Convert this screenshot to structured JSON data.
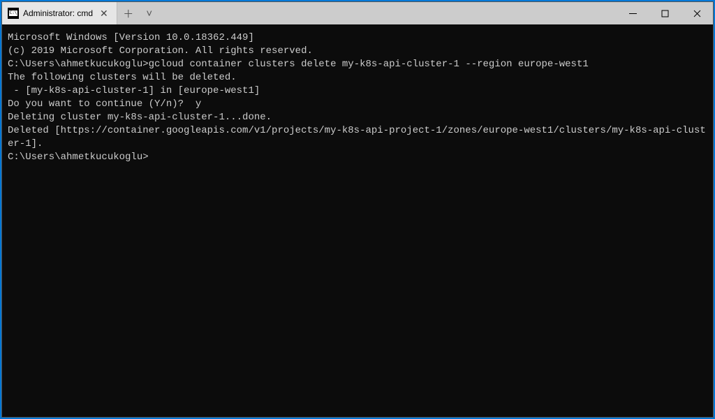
{
  "titlebar": {
    "tab_title": "Administrator: cmd",
    "tab_icon_text": "C:\\",
    "close_tab": "✕",
    "new_tab": "＋",
    "dropdown": "˅"
  },
  "window_controls": {
    "minimize": "—",
    "maximize": "☐",
    "close": "✕"
  },
  "terminal": {
    "line1": "Microsoft Windows [Version 10.0.18362.449]",
    "line2": "(c) 2019 Microsoft Corporation. All rights reserved.",
    "blank1": "",
    "prompt1": "C:\\Users\\ahmetkucukoglu>",
    "cmd1": "gcloud container clusters delete my-k8s-api-cluster-1 --region europe-west1",
    "line3": "The following clusters will be deleted.",
    "line4": " - [my-k8s-api-cluster-1] in [europe-west1]",
    "blank2": "",
    "line5": "Do you want to continue (Y/n)?  y",
    "blank3": "",
    "line6": "Deleting cluster my-k8s-api-cluster-1...done.",
    "line7": "Deleted [https://container.googleapis.com/v1/projects/my-k8s-api-project-1/zones/europe-west1/clusters/my-k8s-api-cluster-1].",
    "blank4": "",
    "prompt2": "C:\\Users\\ahmetkucukoglu>"
  }
}
